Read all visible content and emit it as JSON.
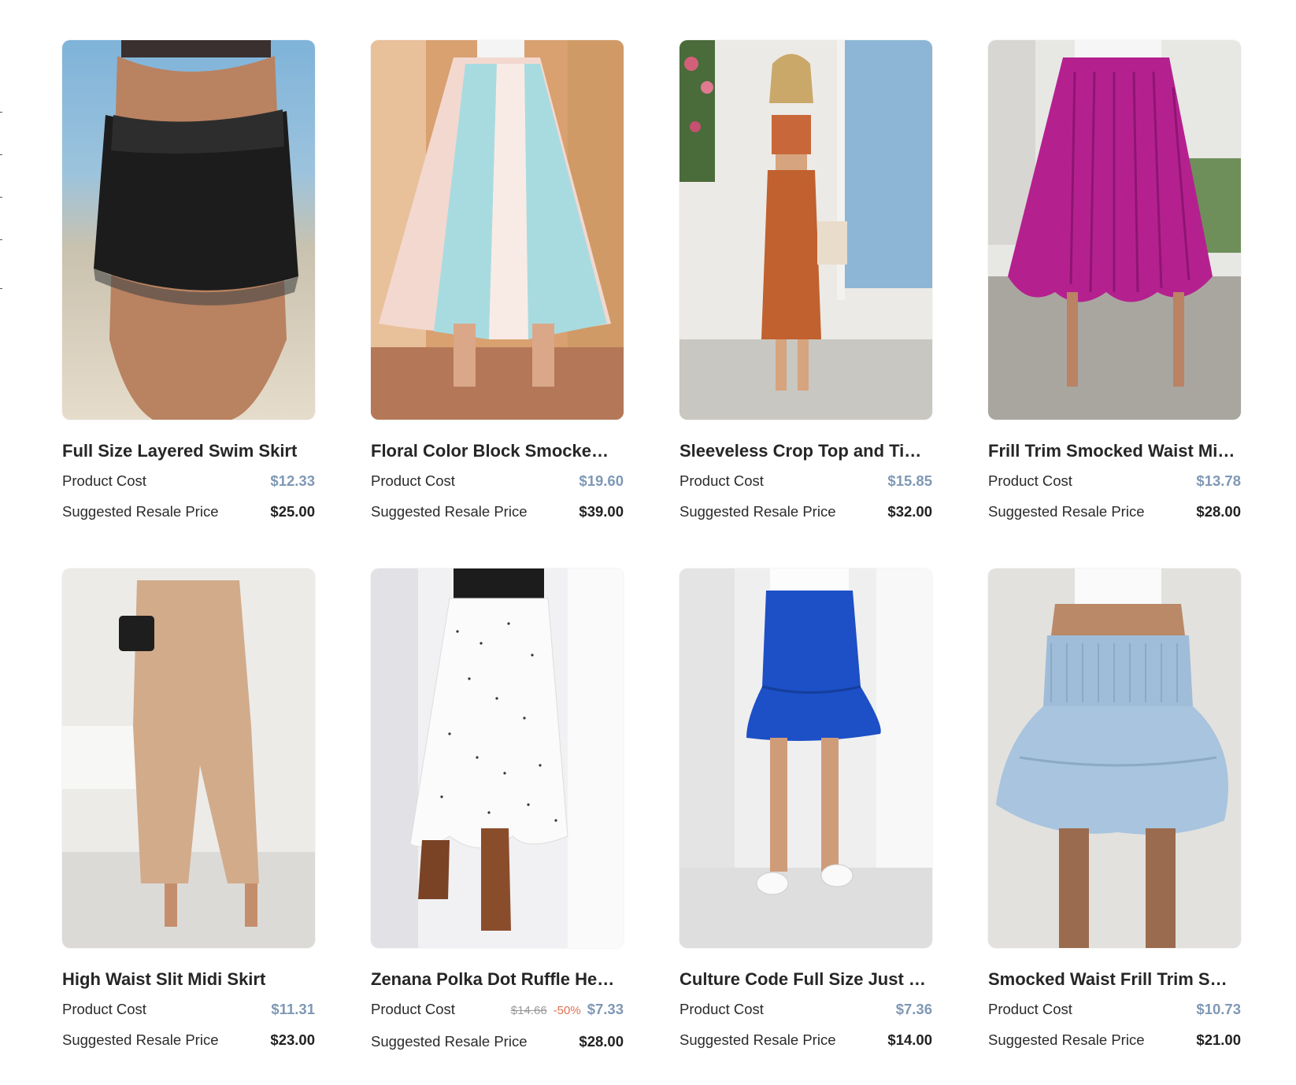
{
  "products": [
    {
      "title": "Full Size Layered Swim Skirt",
      "cost_label": "Product Cost",
      "cost": "$12.33",
      "resale_label": "Suggested Resale Price",
      "resale": "$25.00"
    },
    {
      "title": "Floral Color Block Smocke…",
      "cost_label": "Product Cost",
      "cost": "$19.60",
      "resale_label": "Suggested Resale Price",
      "resale": "$39.00"
    },
    {
      "title": "Sleeveless Crop Top and Ti…",
      "cost_label": "Product Cost",
      "cost": "$15.85",
      "resale_label": "Suggested Resale Price",
      "resale": "$32.00"
    },
    {
      "title": "Frill Trim Smocked Waist Mi…",
      "cost_label": "Product Cost",
      "cost": "$13.78",
      "resale_label": "Suggested Resale Price",
      "resale": "$28.00"
    },
    {
      "title": "High Waist Slit Midi Skirt",
      "cost_label": "Product Cost",
      "cost": "$11.31",
      "resale_label": "Suggested Resale Price",
      "resale": "$23.00"
    },
    {
      "title": "Zenana Polka Dot Ruffle He…",
      "cost_label": "Product Cost",
      "original_cost": "$14.66",
      "discount": "-50%",
      "cost": "$7.33",
      "resale_label": "Suggested Resale Price",
      "resale": "$28.00"
    },
    {
      "title": "Culture Code Full Size Just …",
      "cost_label": "Product Cost",
      "cost": "$7.36",
      "resale_label": "Suggested Resale Price",
      "resale": "$14.00"
    },
    {
      "title": "Smocked Waist Frill Trim S…",
      "cost_label": "Product Cost",
      "cost": "$10.73",
      "resale_label": "Suggested Resale Price",
      "resale": "$21.00"
    }
  ],
  "colors": {
    "cost_price": "#7f98b5",
    "discount": "#e07050"
  }
}
